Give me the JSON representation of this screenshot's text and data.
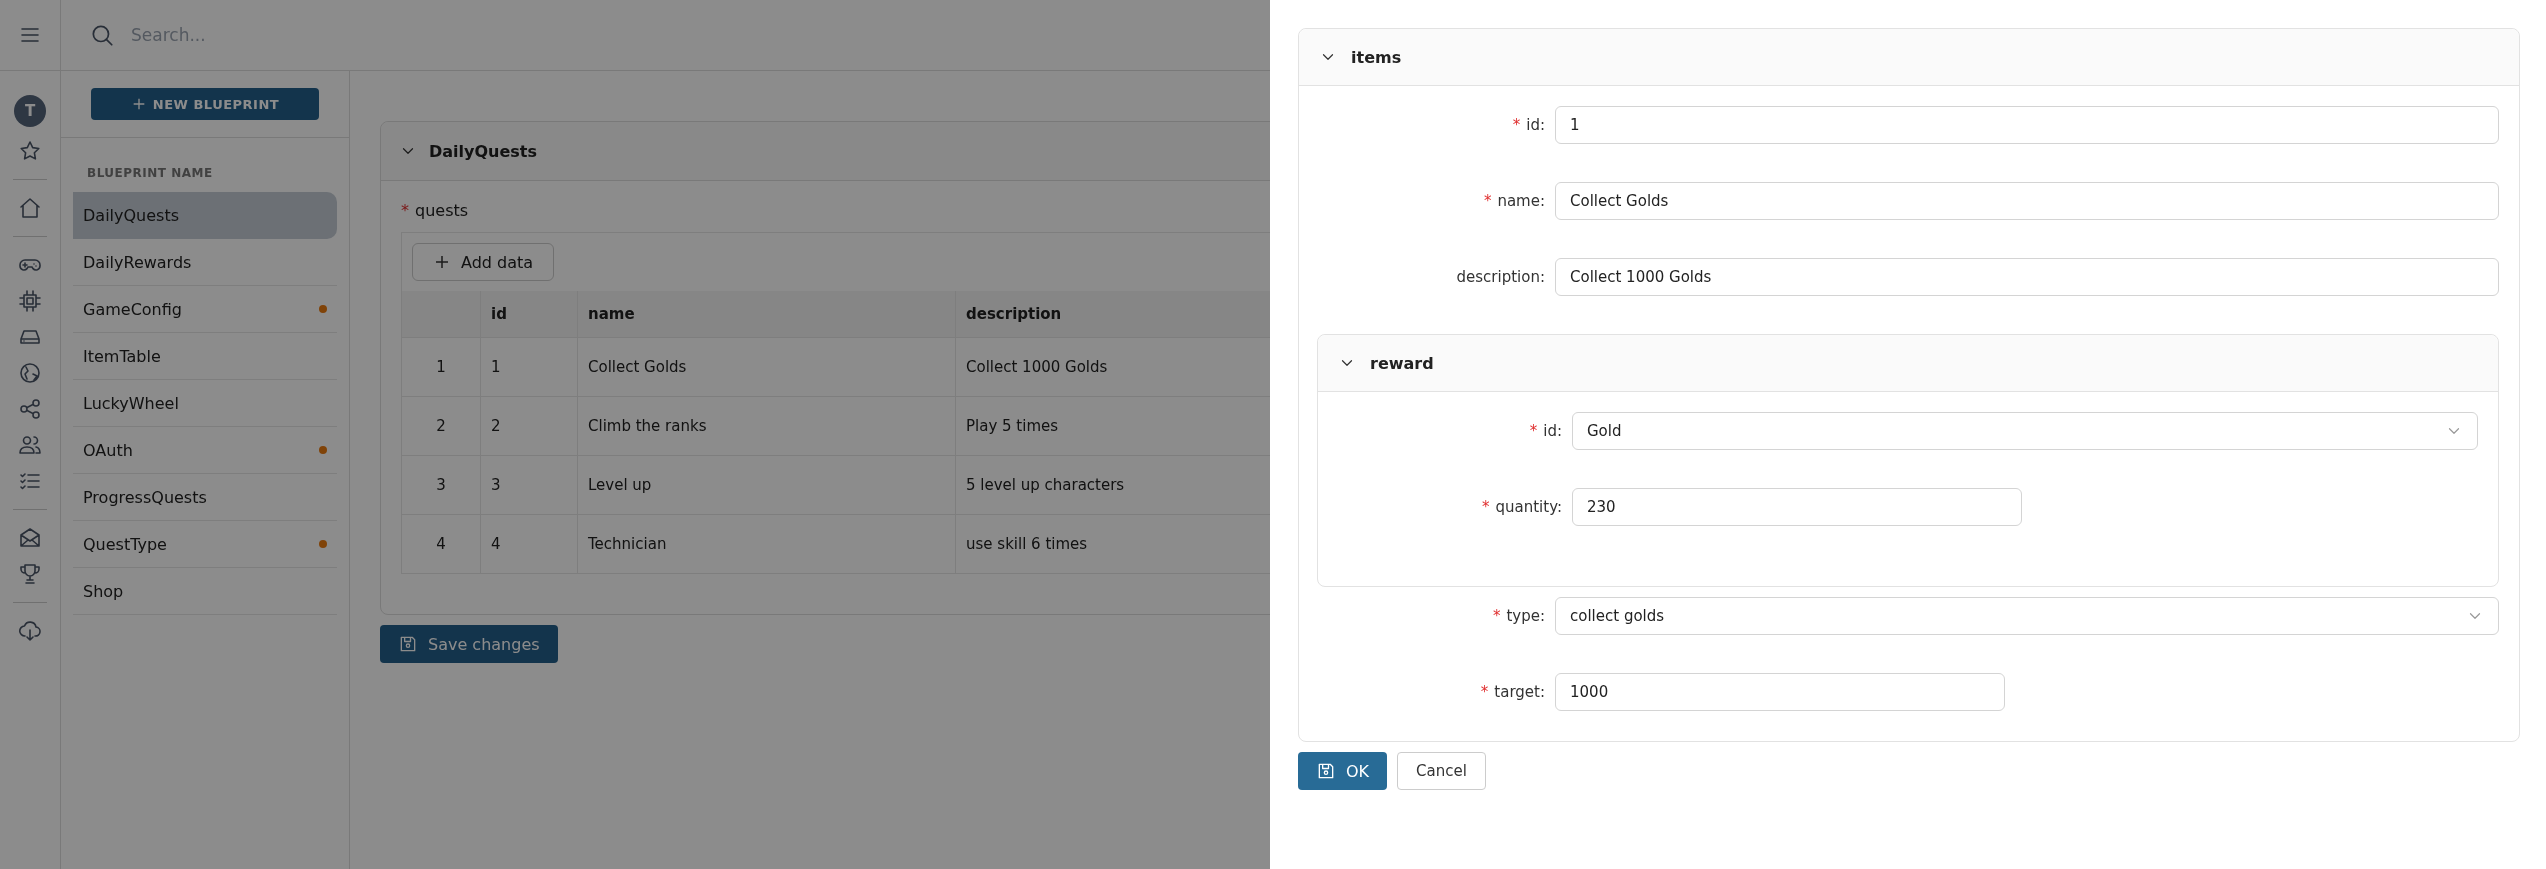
{
  "required_mark": "*",
  "rail": {
    "avatar": "T"
  },
  "search": {
    "placeholder": "Search..."
  },
  "new_button": {
    "label": "NEW BLUEPRINT"
  },
  "blueprints": {
    "heading": "BLUEPRINT NAME",
    "items": [
      {
        "name": "DailyQuests",
        "selected": true,
        "modified": false
      },
      {
        "name": "DailyRewards",
        "selected": false,
        "modified": false
      },
      {
        "name": "GameConfig",
        "selected": false,
        "modified": true
      },
      {
        "name": "ItemTable",
        "selected": false,
        "modified": false
      },
      {
        "name": "LuckyWheel",
        "selected": false,
        "modified": false
      },
      {
        "name": "OAuth",
        "selected": false,
        "modified": true
      },
      {
        "name": "ProgressQuests",
        "selected": false,
        "modified": false
      },
      {
        "name": "QuestType",
        "selected": false,
        "modified": true
      },
      {
        "name": "Shop",
        "selected": false,
        "modified": false
      }
    ]
  },
  "panel": {
    "title": "DailyQuests",
    "expanded": true,
    "field_label": "quests",
    "required": true,
    "add_button": "Add data",
    "table": {
      "columns": [
        "id",
        "name",
        "description"
      ],
      "rows": [
        {
          "index": "1",
          "cells": [
            "1",
            "Collect Golds",
            "Collect 1000 Golds"
          ]
        },
        {
          "index": "2",
          "cells": [
            "2",
            "Climb the ranks",
            "Play 5 times"
          ]
        },
        {
          "index": "3",
          "cells": [
            "3",
            "Level up",
            "5 level up characters"
          ]
        },
        {
          "index": "4",
          "cells": [
            "4",
            "Technician",
            "use skill 6 times"
          ]
        }
      ]
    }
  },
  "save_button": "Save changes",
  "drawer": {
    "section": {
      "title": "items",
      "expanded": true,
      "fields": [
        {
          "kind": "text",
          "label": "id:",
          "required": true,
          "value": "1"
        },
        {
          "kind": "text",
          "label": "name:",
          "required": true,
          "value": "Collect Golds"
        },
        {
          "kind": "text",
          "label": "description:",
          "required": false,
          "value": "Collect 1000 Golds"
        },
        {
          "kind": "group",
          "title": "reward",
          "expanded": true,
          "fields": [
            {
              "kind": "select",
              "label": "id:",
              "required": true,
              "value": "Gold"
            },
            {
              "kind": "number",
              "label": "quantity:",
              "required": true,
              "value": "230"
            }
          ]
        },
        {
          "kind": "select",
          "label": "type:",
          "required": true,
          "value": "collect golds"
        },
        {
          "kind": "number",
          "label": "target:",
          "required": true,
          "value": "1000"
        }
      ]
    },
    "ok_button": "OK",
    "cancel_button": "Cancel"
  }
}
